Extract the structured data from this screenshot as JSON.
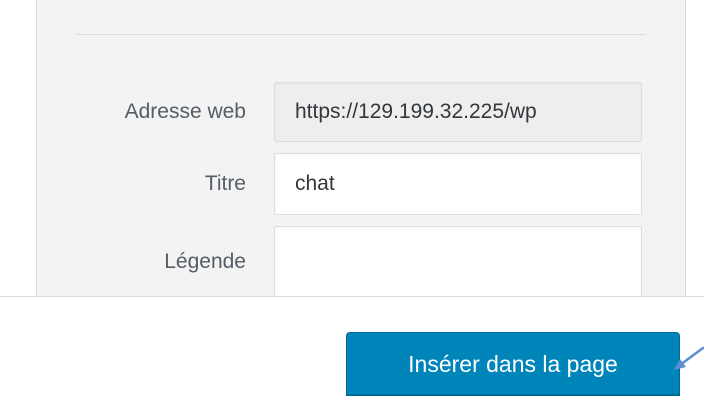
{
  "attachment_details": {
    "url_label": "Adresse web",
    "url_value": "https://129.199.32.225/wp",
    "title_label": "Titre",
    "title_value": "chat",
    "caption_label": "Légende",
    "caption_value": ""
  },
  "toolbar": {
    "insert_button_label": "Insérer dans la page"
  },
  "colors": {
    "primary_button": "#0085ba",
    "panel_background": "#f3f3f3",
    "annotation_arrow": "#5b8fd1"
  },
  "icons": {
    "annotation": "arrow-pointer-icon"
  }
}
